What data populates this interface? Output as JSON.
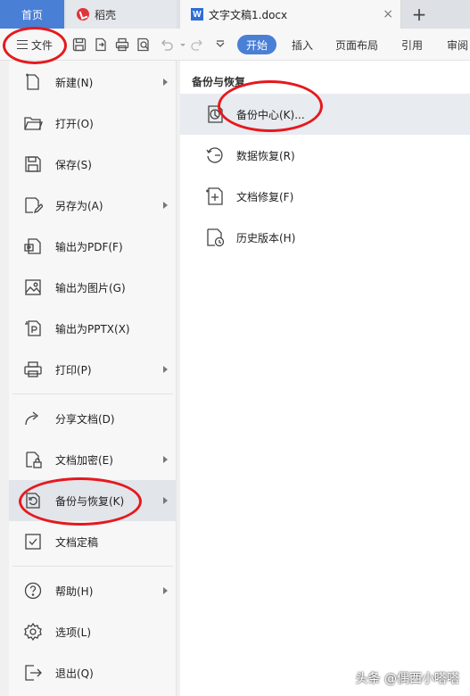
{
  "tabs": {
    "home": "首页",
    "daoke": "稻壳",
    "document": "文字文稿1.docx",
    "close_glyph": "×",
    "add_glyph": "+"
  },
  "toolbar": {
    "file_label": "文件",
    "ribbon_tabs": [
      {
        "label": "开始",
        "active": true
      },
      {
        "label": "插入",
        "active": false
      },
      {
        "label": "页面布局",
        "active": false
      },
      {
        "label": "引用",
        "active": false
      },
      {
        "label": "审阅",
        "active": false
      }
    ],
    "icons": [
      "save-icon",
      "export-icon",
      "print-icon",
      "print-preview-icon",
      "undo-icon",
      "redo-icon",
      "customize-icon"
    ]
  },
  "file_menu": {
    "items": [
      {
        "label": "新建(N)",
        "icon": "new-file-icon",
        "submenu": true
      },
      {
        "label": "打开(O)",
        "icon": "folder-open-icon",
        "submenu": false
      },
      {
        "label": "保存(S)",
        "icon": "save-icon",
        "submenu": false
      },
      {
        "label": "另存为(A)",
        "icon": "save-as-icon",
        "submenu": true
      },
      {
        "label": "输出为PDF(F)",
        "icon": "pdf-icon",
        "submenu": false
      },
      {
        "label": "输出为图片(G)",
        "icon": "image-icon",
        "submenu": false
      },
      {
        "label": "输出为PPTX(X)",
        "icon": "pptx-icon",
        "submenu": false
      },
      {
        "label": "打印(P)",
        "icon": "print-icon",
        "submenu": true
      },
      {
        "label": "分享文档(D)",
        "icon": "share-icon",
        "submenu": false
      },
      {
        "label": "文档加密(E)",
        "icon": "encrypt-icon",
        "submenu": true
      },
      {
        "label": "备份与恢复(K)",
        "icon": "backup-restore-icon",
        "submenu": true,
        "active": true
      },
      {
        "label": "文档定稿",
        "icon": "finalize-icon",
        "submenu": false
      },
      {
        "label": "帮助(H)",
        "icon": "help-icon",
        "submenu": true
      },
      {
        "label": "选项(L)",
        "icon": "settings-icon",
        "submenu": false
      },
      {
        "label": "退出(Q)",
        "icon": "exit-icon",
        "submenu": false
      }
    ]
  },
  "backup_panel": {
    "title": "备份与恢复",
    "items": [
      {
        "label": "备份中心(K)...",
        "icon": "backup-center-icon",
        "active": true
      },
      {
        "label": "数据恢复(R)",
        "icon": "data-recovery-icon"
      },
      {
        "label": "文档修复(F)",
        "icon": "document-repair-icon"
      },
      {
        "label": "历史版本(H)",
        "icon": "history-version-icon"
      }
    ]
  },
  "colors": {
    "accent": "#4a7fd6",
    "annotation": "#e5191e",
    "daoke_brand": "#e0353a"
  },
  "watermark": "头条 @偶西小嗒嗒"
}
